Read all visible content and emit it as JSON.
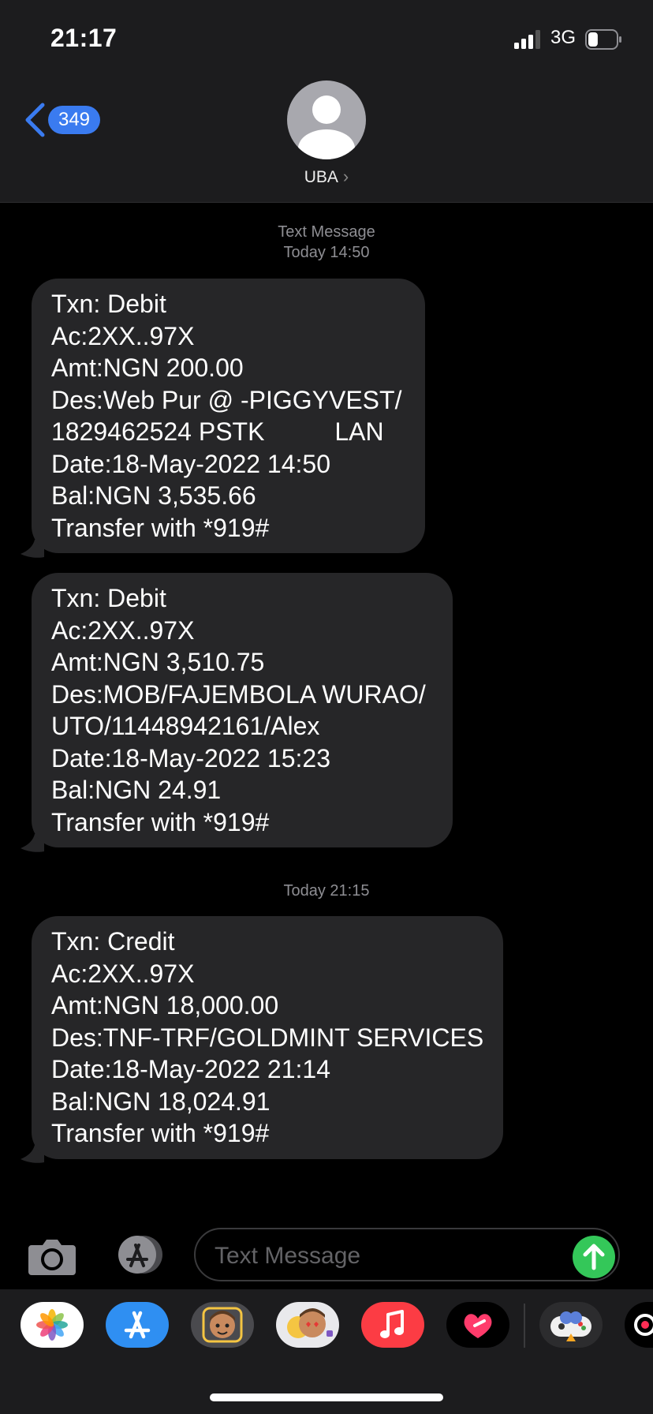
{
  "status_bar": {
    "time": "21:17",
    "network": "3G"
  },
  "header": {
    "back_count": "349",
    "contact_name": "UBA",
    "chevron": "›"
  },
  "thread": {
    "timestamp_1_label": "Text Message",
    "timestamp_1_time": "Today 14:50",
    "timestamp_2_time": "Today 21:15",
    "messages": [
      {
        "lines": [
          "Txn: Debit",
          "Ac:2XX..97X",
          "Amt:NGN 200.00",
          "Des:Web Pur @ -PIGGYVEST/",
          "1829462524 PSTK          LAN",
          "Date:18-May-2022 14:50",
          "Bal:NGN 3,535.66",
          "Transfer with *919#"
        ]
      },
      {
        "lines": [
          "Txn: Debit",
          "Ac:2XX..97X",
          "Amt:NGN 3,510.75",
          "Des:MOB/FAJEMBOLA WURAO/",
          "UTO/11448942161/Alex",
          "Date:18-May-2022 15:23",
          "Bal:NGN 24.91",
          "Transfer with *919#"
        ]
      },
      {
        "lines": [
          "Txn: Credit",
          "Ac:2XX..97X",
          "Amt:NGN 18,000.00",
          "Des:TNF-TRF/GOLDMINT SERVICES",
          "Date:18-May-2022 21:14",
          "Bal:NGN 18,024.91",
          "Transfer with *919#"
        ]
      }
    ]
  },
  "input_bar": {
    "placeholder": "Text Message"
  },
  "icons": {
    "camera": "camera-icon",
    "apps": "app-store-icon",
    "send": "send-arrow-icon",
    "tray": [
      "photos-icon",
      "app-store-icon",
      "memoji-icon",
      "animoji-stickers-icon",
      "music-icon",
      "digital-touch-icon",
      "game-pigeon-icon",
      "partial-app-icon"
    ]
  },
  "colors": {
    "accent": "#3a7bf0",
    "send": "#34c759",
    "bubble": "#262628",
    "header": "#1c1c1e",
    "battery_level": 0.35
  }
}
